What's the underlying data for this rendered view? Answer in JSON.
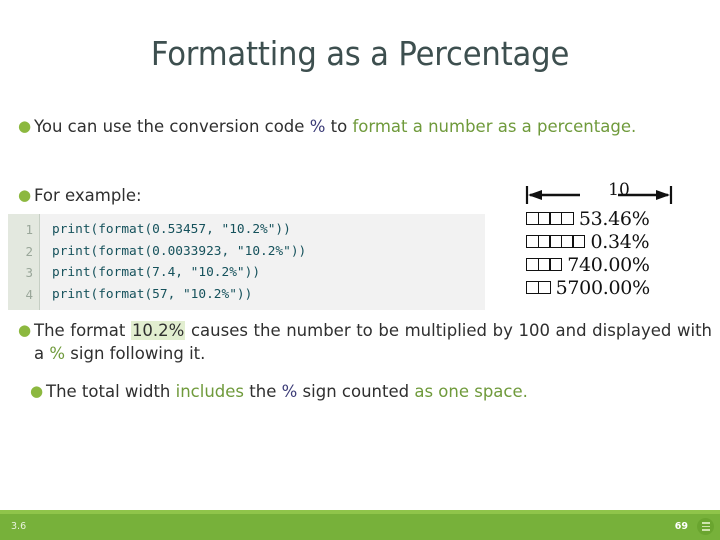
{
  "slide": {
    "title": "Formatting as a Percentage",
    "bullets": [
      {
        "name": "bullet-conversion-code",
        "segments": [
          {
            "text": "You can use the conversion code ",
            "style": "plain"
          },
          {
            "text": "%",
            "style": "purple"
          },
          {
            "text": " to ",
            "style": "plain"
          },
          {
            "text": "format a number as a percentage.",
            "style": "green"
          }
        ]
      },
      {
        "name": "bullet-for-example",
        "segments": [
          {
            "text": "For example:",
            "style": "plain"
          }
        ]
      },
      {
        "name": "bullet-format-explanation",
        "segments": [
          {
            "text": "The format ",
            "style": "plain"
          },
          {
            "text": "10.2%",
            "style": "highlight"
          },
          {
            "text": " causes the number to be multiplied by 100 and displayed with a ",
            "style": "plain"
          },
          {
            "text": "%",
            "style": "green"
          },
          {
            "text": " sign following it.",
            "style": "plain"
          }
        ]
      },
      {
        "name": "bullet-total-width",
        "segments": [
          {
            "text": "The total width ",
            "style": "plain"
          },
          {
            "text": "includes",
            "style": "green"
          },
          {
            "text": " the ",
            "style": "plain"
          },
          {
            "text": "%",
            "style": "purple"
          },
          {
            "text": " sign counted ",
            "style": "plain"
          },
          {
            "text": "as one space.",
            "style": "green"
          }
        ]
      }
    ]
  },
  "code": {
    "line_numbers": [
      "1",
      "2",
      "3",
      "4"
    ],
    "lines": [
      "print(format(0.53457, \"10.2%\"))",
      "print(format(0.0033923, \"10.2%\"))",
      "print(format(7.4, \"10.2%\"))",
      "print(format(57, \"10.2%\"))"
    ]
  },
  "diagram": {
    "width_label": "10",
    "rows": [
      {
        "pad_boxes": 4,
        "value": "53.46%"
      },
      {
        "pad_boxes": 5,
        "value": "0.34%"
      },
      {
        "pad_boxes": 3,
        "value": "740.00%"
      },
      {
        "pad_boxes": 2,
        "value": "5700.00%"
      }
    ]
  },
  "footer": {
    "section": "3.6",
    "page_number": "69",
    "menu_icon": "hamburger-icon"
  },
  "colors": {
    "accent_green": "#77b13a",
    "text_green": "#6f9a3b",
    "text_purple": "#3b3b77",
    "title": "#3d4f4f",
    "code_text": "#16525c",
    "highlight_bg": "#e2eed0"
  }
}
